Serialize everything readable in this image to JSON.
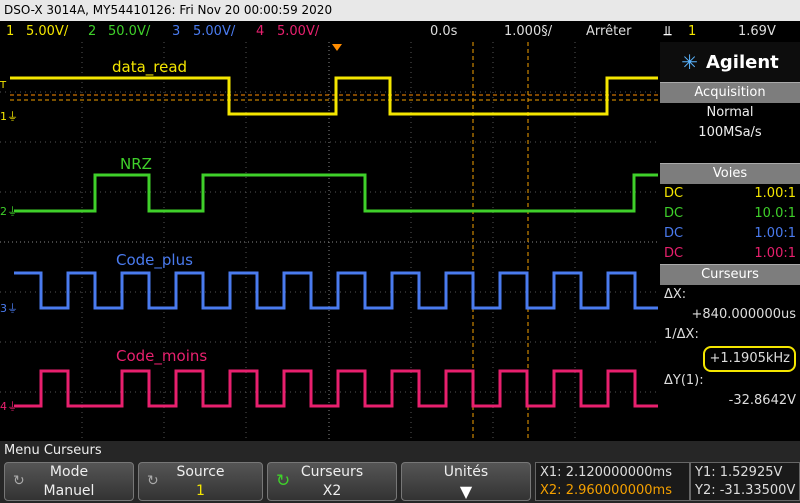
{
  "title_bar": "DSO-X 3014A, MY54410126: Fri Nov 20 00:00:59 2020",
  "status": {
    "ch1_num": "1",
    "ch1_scale": "5.00V/",
    "ch2_num": "2",
    "ch2_scale": "50.0V/",
    "ch3_num": "3",
    "ch3_scale": "5.00V/",
    "ch4_num": "4",
    "ch4_scale": "5.00V/",
    "time_delay": "0.0s",
    "time_scale": "1.000§/",
    "run_state": "Arrêter",
    "trigger_source": "1",
    "trigger_level": "1.69V"
  },
  "traces": {
    "data_read": {
      "label": "data_read",
      "color": "#f4e600"
    },
    "nrz": {
      "label": "NRZ",
      "color": "#3fd02a"
    },
    "code_plus": {
      "label": "Code_plus",
      "color": "#4a7bef"
    },
    "code_moins": {
      "label": "Code_moins",
      "color": "#e8206e"
    }
  },
  "panel": {
    "brand": "Agilent",
    "acq_head": "Acquisition",
    "acq_mode": "Normal",
    "acq_rate": "100MSa/s",
    "voies_head": "Voies",
    "voies": [
      {
        "coupling": "DC",
        "ratio": "1.00:1",
        "color": "#f4e600"
      },
      {
        "coupling": "DC",
        "ratio": "10.0:1",
        "color": "#3fd02a"
      },
      {
        "coupling": "DC",
        "ratio": "1.00:1",
        "color": "#4a7bef"
      },
      {
        "coupling": "DC",
        "ratio": "1.00:1",
        "color": "#e8206e"
      }
    ],
    "cursors_head": "Curseurs",
    "dx_label": "ΔX:",
    "dx_value": "+840.000000us",
    "inv_dx_label": "1/ΔX:",
    "inv_dx_value": "+1.1905kHz",
    "dy_label": "ΔY(1):",
    "dy_value": "-32.8642V"
  },
  "menu": {
    "title": "Menu Curseurs",
    "mode_label": "Mode",
    "mode_value": "Manuel",
    "source_label": "Source",
    "source_value": "1",
    "cursors_label": "Curseurs",
    "cursors_value": "X2",
    "units_label": "Unités"
  },
  "readouts": {
    "x1": "X1: 2.120000000ms",
    "x2": "X2: 2.960000000ms",
    "y1": "Y1: 1.52925V",
    "y2": "Y2: -31.33500V"
  }
}
